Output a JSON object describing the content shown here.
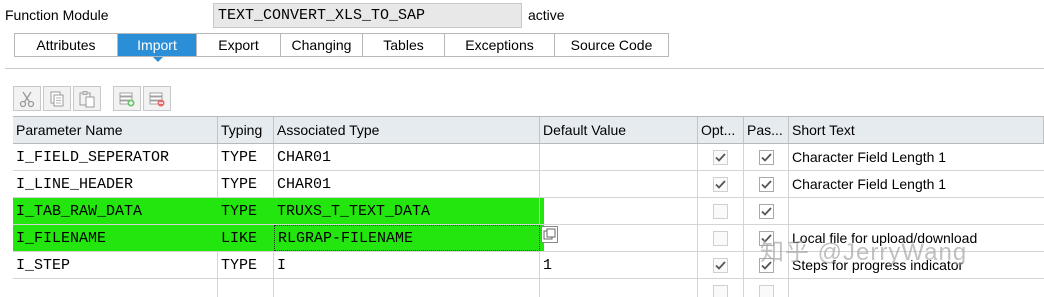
{
  "header": {
    "label": "Function Module",
    "name": "TEXT_CONVERT_XLS_TO_SAP",
    "status": "active"
  },
  "tabs": [
    {
      "label": "Attributes",
      "active": false
    },
    {
      "label": "Import",
      "active": true
    },
    {
      "label": "Export",
      "active": false
    },
    {
      "label": "Changing",
      "active": false
    },
    {
      "label": "Tables",
      "active": false
    },
    {
      "label": "Exceptions",
      "active": false
    },
    {
      "label": "Source Code",
      "active": false
    }
  ],
  "toolbar": {
    "buttons": [
      "cut-icon",
      "copy-icon",
      "paste-icon",
      "insert-row-icon",
      "delete-row-icon"
    ]
  },
  "grid": {
    "columns": {
      "name": "Parameter Name",
      "typing": "Typing",
      "assoc": "Associated Type",
      "default": "Default Value",
      "opt": "Opt...",
      "pass": "Pas...",
      "short": "Short Text"
    },
    "rows": [
      {
        "name": "I_FIELD_SEPERATOR",
        "typing": "TYPE",
        "assoc": "CHAR01",
        "default": "",
        "opt": true,
        "pass": true,
        "short": "Character Field Length 1"
      },
      {
        "name": "I_LINE_HEADER",
        "typing": "TYPE",
        "assoc": "CHAR01",
        "default": "",
        "opt": true,
        "pass": true,
        "short": "Character Field Length 1"
      },
      {
        "name": "I_TAB_RAW_DATA",
        "typing": "TYPE",
        "assoc": "TRUXS_T_TEXT_DATA",
        "default": "",
        "opt": false,
        "pass": true,
        "short": ""
      },
      {
        "name": "I_FILENAME",
        "typing": "LIKE",
        "assoc": "RLGRAP-FILENAME",
        "default": "",
        "opt": false,
        "pass": true,
        "short": "Local file for upload/download"
      },
      {
        "name": "I_STEP",
        "typing": "TYPE",
        "assoc": "I",
        "default": "1",
        "opt": true,
        "pass": true,
        "short": "Steps for progress indicator"
      },
      {
        "name": "",
        "typing": "",
        "assoc": "",
        "default": "",
        "opt": false,
        "pass": false,
        "short": ""
      }
    ]
  },
  "watermark": "知乎 @JerryWang",
  "colors": {
    "active_tab": "#2a8fd6",
    "highlight": "#22e60e",
    "header_bg": "#e6ebef"
  }
}
